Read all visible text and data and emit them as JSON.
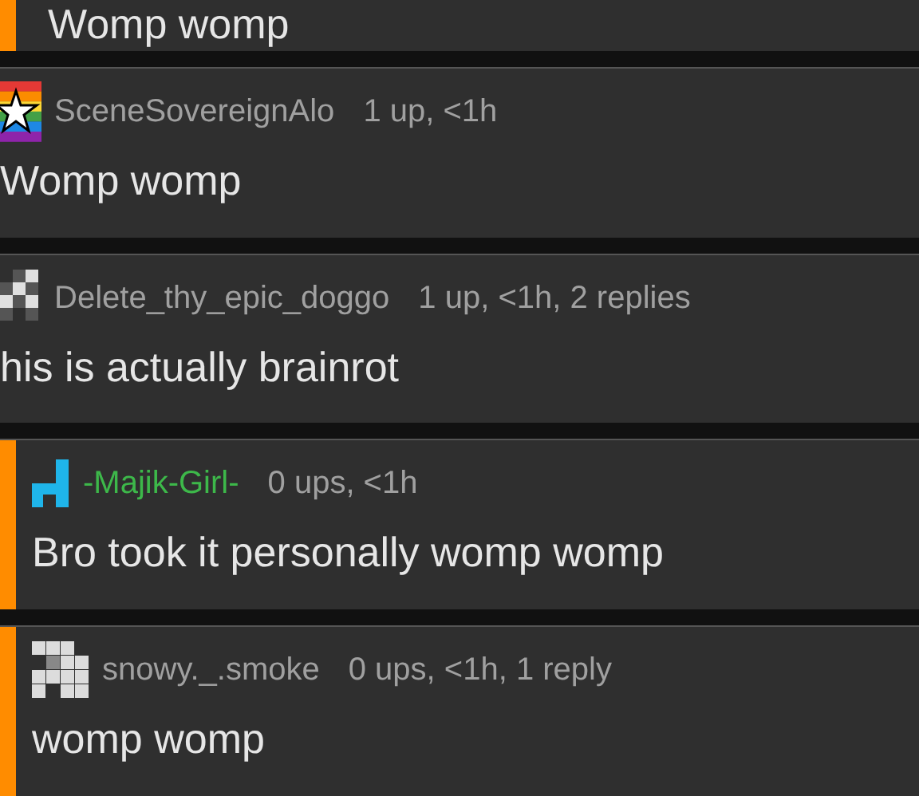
{
  "comments": [
    {
      "kind": "reply",
      "body": "Womp womp"
    },
    {
      "kind": "top",
      "avatar": {
        "kind": "star"
      },
      "username": "SceneSovereignAlo",
      "color": "#a0a0a0",
      "meta": "1 up, <1h",
      "body": "Womp womp"
    },
    {
      "kind": "top",
      "avatar": {
        "kind": "checker"
      },
      "username": "Delete_thy_epic_doggo",
      "color": "#a0a0a0",
      "meta": "1 up, <1h, 2 replies",
      "body": "his is actually brainrot"
    },
    {
      "kind": "reply",
      "avatar": {
        "kind": "blue"
      },
      "username": "-Majik-Girl-",
      "color": "#3db84a",
      "meta": "0 ups, <1h",
      "body": "Bro took it personally womp womp"
    },
    {
      "kind": "reply",
      "avatar": {
        "kind": "white"
      },
      "username": "snowy._.smoke",
      "color": "#a0a0a0",
      "meta": "0 ups, <1h, 1 reply",
      "body": "womp womp"
    }
  ]
}
